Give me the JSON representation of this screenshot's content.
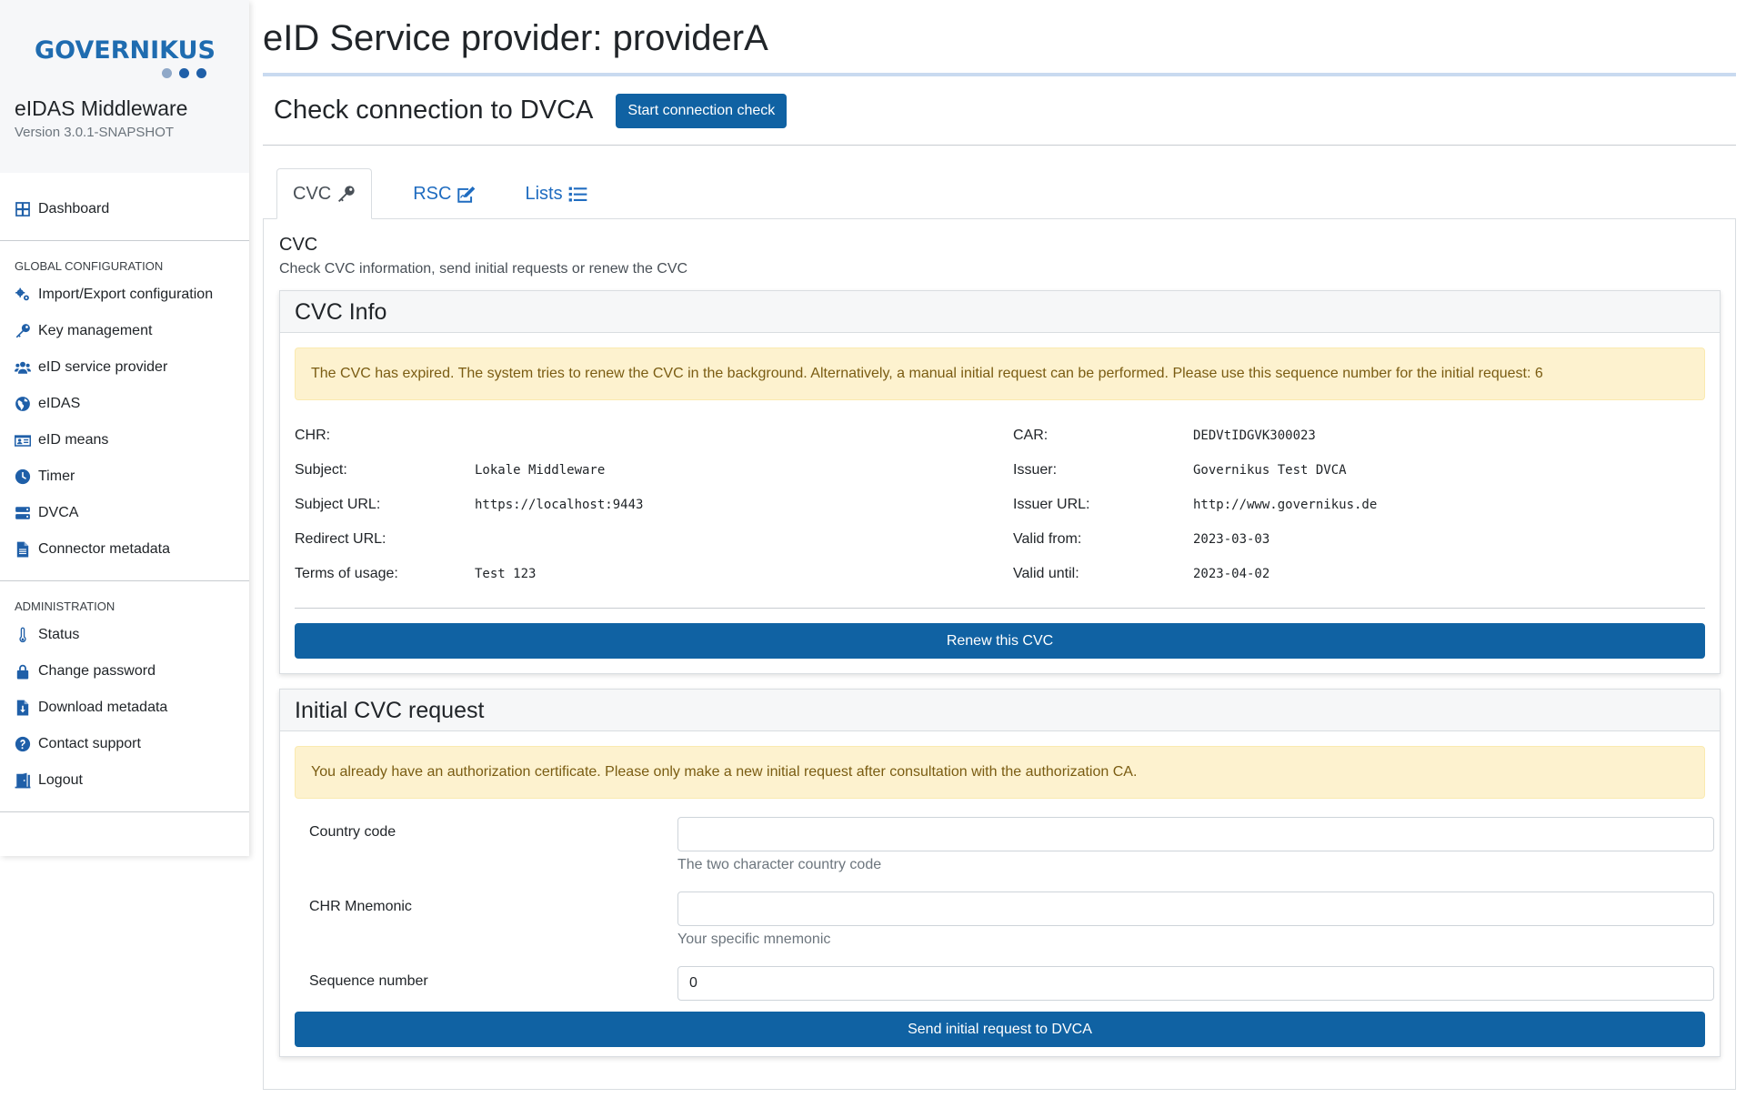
{
  "sidebar": {
    "logo": "GOVERNIKUS",
    "logo_dot_colors": [
      "#8fa8c8",
      "#1f5fa8",
      "#1f5fa8"
    ],
    "app_name": "eIDAS Middleware",
    "version": "Version 3.0.1-SNAPSHOT",
    "dashboard": {
      "label": "Dashboard",
      "icon": "grid-icon"
    },
    "global_heading": "GLOBAL CONFIGURATION",
    "global_items": [
      {
        "label": "Import/Export configuration",
        "icon": "gears-icon"
      },
      {
        "label": "Key management",
        "icon": "key-icon"
      },
      {
        "label": "eID service provider",
        "icon": "users-icon"
      },
      {
        "label": "eIDAS",
        "icon": "globe-icon"
      },
      {
        "label": "eID means",
        "icon": "id-card-icon"
      },
      {
        "label": "Timer",
        "icon": "clock-icon"
      },
      {
        "label": "DVCA",
        "icon": "server-icon"
      },
      {
        "label": "Connector metadata",
        "icon": "file-icon"
      }
    ],
    "admin_heading": "ADMINISTRATION",
    "admin_items": [
      {
        "label": "Status",
        "icon": "thermometer-icon"
      },
      {
        "label": "Change password",
        "icon": "lock-icon"
      },
      {
        "label": "Download metadata",
        "icon": "file-download-icon"
      },
      {
        "label": "Contact support",
        "icon": "question-icon"
      },
      {
        "label": "Logout",
        "icon": "door-icon"
      }
    ]
  },
  "main": {
    "title": "eID Service provider: providerA",
    "connection_title": "Check connection to DVCA",
    "connection_button": "Start connection check",
    "tabs": [
      {
        "label": "CVC",
        "icon": "key-icon"
      },
      {
        "label": "RSC",
        "icon": "signature-icon"
      },
      {
        "label": "Lists",
        "icon": "list-icon"
      }
    ],
    "section_title": "CVC",
    "section_subtitle": "Check CVC information, send initial requests or renew the CVC",
    "cvc_info": {
      "header": "CVC Info",
      "alert": "The CVC has expired. The system tries to renew the CVC in the background. Alternatively, a manual initial request can be performed. Please use this sequence number for the initial request: 6",
      "left": [
        {
          "label": "CHR:",
          "value": ""
        },
        {
          "label": "Subject:",
          "value": "Lokale Middleware"
        },
        {
          "label": "Subject URL:",
          "value": "https://localhost:9443"
        },
        {
          "label": "Redirect URL:",
          "value": ""
        },
        {
          "label": "Terms of usage:",
          "value": "Test 123"
        }
      ],
      "right": [
        {
          "label": "CAR:",
          "value": "DEDVtIDGVK300023"
        },
        {
          "label": "Issuer:",
          "value": "Governikus Test DVCA"
        },
        {
          "label": "Issuer URL:",
          "value": "http://www.governikus.de"
        },
        {
          "label": "Valid from:",
          "value": "2023-03-03"
        },
        {
          "label": "Valid until:",
          "value": "2023-04-02"
        }
      ],
      "renew_button": "Renew this CVC"
    },
    "initial_request": {
      "header": "Initial CVC request",
      "alert": "You already have an authorization certificate. Please only make a new initial request after consultation with the authorization CA.",
      "country_code": {
        "label": "Country code",
        "value": "",
        "help": "The two character country code"
      },
      "chr_mnemonic": {
        "label": "CHR Mnemonic",
        "value": "",
        "help": "Your specific mnemonic"
      },
      "sequence_number": {
        "label": "Sequence number",
        "value": "0"
      },
      "send_button": "Send initial request to DVCA"
    }
  }
}
